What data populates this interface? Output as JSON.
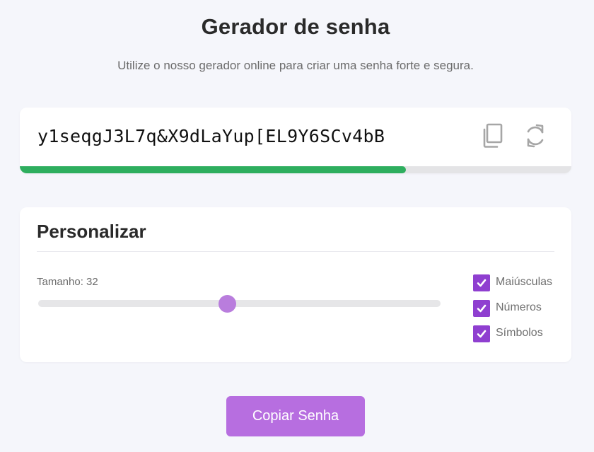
{
  "header": {
    "title": "Gerador de senha",
    "subtitle": "Utilize o nosso gerador online para criar uma senha forte e segura."
  },
  "password": {
    "value": "y1seqgJ3L7q&X9dLaYup[EL9Y6SCv4bB",
    "copy_icon": "copy-icon",
    "refresh_icon": "refresh-icon",
    "strength_fraction": 0.7,
    "strength_color": "#2eae5e"
  },
  "customize": {
    "title": "Personalizar",
    "length_label": "Tamanho: 32",
    "slider_fraction": 0.47,
    "accent_color": "#b97ddd",
    "options": [
      {
        "label": "Maiúsculas",
        "checked": true
      },
      {
        "label": "Números",
        "checked": true
      },
      {
        "label": "Símbolos",
        "checked": true
      }
    ]
  },
  "actions": {
    "copy_label": "Copiar Senha"
  }
}
